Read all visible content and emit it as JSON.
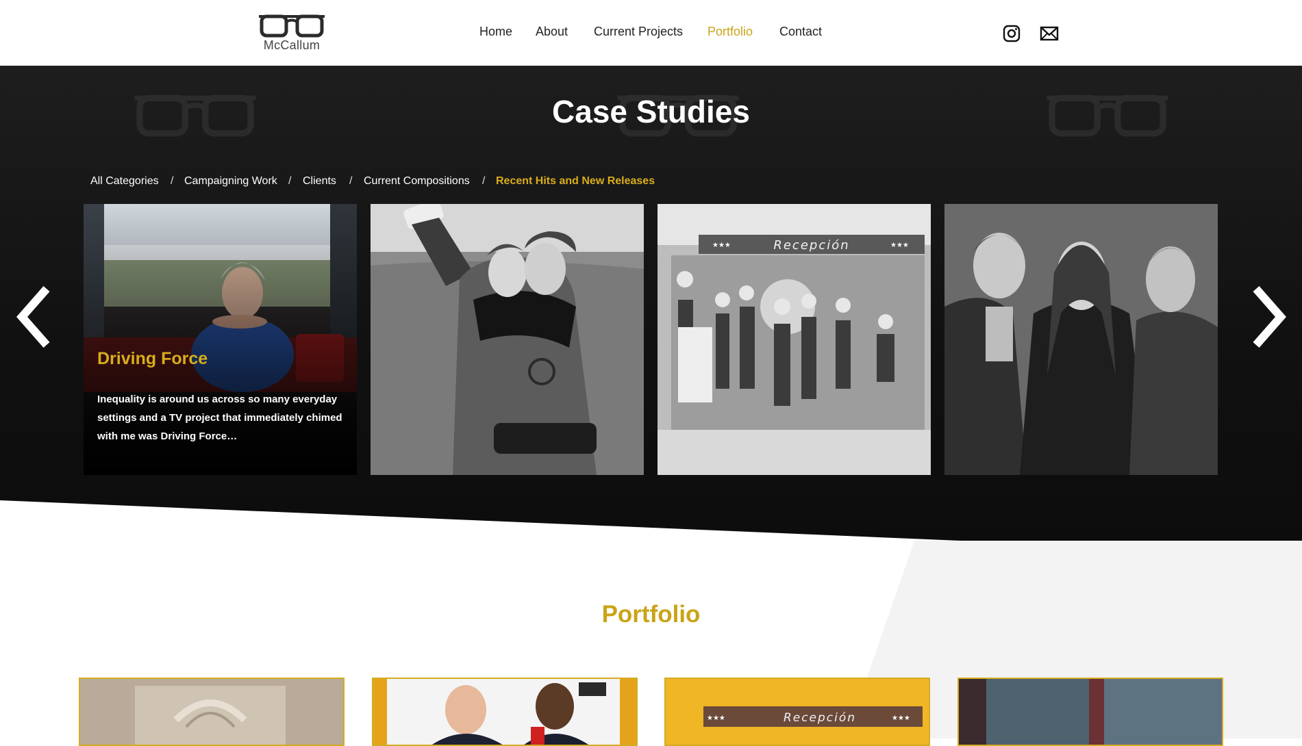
{
  "brand": {
    "logo_text": "McCallum"
  },
  "nav": {
    "items": [
      {
        "label": "Home"
      },
      {
        "label": "About"
      },
      {
        "label": "Current Projects"
      },
      {
        "label": "Portfolio"
      },
      {
        "label": "Contact"
      }
    ],
    "active": "Portfolio"
  },
  "social": {
    "instagram_icon": "instagram-icon",
    "mail_icon": "mail-icon"
  },
  "hero": {
    "title": "Case Studies",
    "filters": [
      {
        "label": "All Categories"
      },
      {
        "label": "Campaigning Work"
      },
      {
        "label": "Clients"
      },
      {
        "label": "Current Compositions"
      },
      {
        "label": "Recent Hits and New Releases"
      }
    ],
    "separator": "/",
    "active_filter": "Recent Hits and New Releases",
    "cards": [
      {
        "title": "Driving Force",
        "text": "Inequality is around us across so many everyday settings and a TV project that immediately chimed with me was Driving Force…"
      },
      {
        "sign": "Recepción"
      }
    ],
    "prev_icon": "chevron-left-icon",
    "next_icon": "chevron-right-icon"
  },
  "portfolio": {
    "title": "Portfolio",
    "cards": [
      {
        "sign": "Recepción"
      }
    ]
  },
  "colors": {
    "accent": "#d9ad1a",
    "dark": "#111111",
    "nav_active": "#c9a416"
  }
}
